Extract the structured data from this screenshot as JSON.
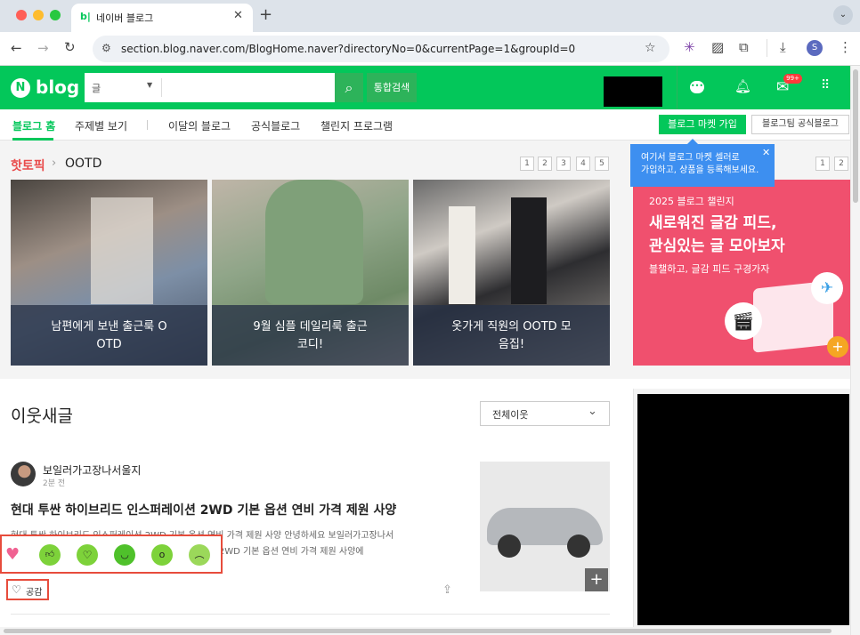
{
  "browser": {
    "tab_title": "네이버 블로그",
    "tab_favicon": "b|",
    "url": "section.blog.naver.com/BlogHome.naver?directoryNo=0&currentPage=1&groupId=0",
    "profile_initial": "S"
  },
  "header": {
    "logo_n": "N",
    "logo_text": "blog",
    "search_scope": "글",
    "search_value": "",
    "search_button": "통합검색",
    "notification_badge": "99+"
  },
  "gnb": {
    "items": [
      "블로그 홈",
      "주제별 보기",
      "이달의 블로그",
      "공식블로그",
      "챌린지 프로그램"
    ],
    "market_button": "블로그 마켓 가입",
    "official_button": "블로그팀 공식블로그"
  },
  "tooltip": {
    "line1": "여기서 블로그 마켓 셀러로",
    "line2": "가입하고, 상품을 등록해보세요."
  },
  "hot_topic": {
    "label": "핫토픽",
    "category": "OOTD",
    "pages": [
      "1",
      "2",
      "3",
      "4",
      "5"
    ],
    "cards": [
      {
        "l1": "남편에게 보낸 출근룩 O",
        "l2": "OTD"
      },
      {
        "l1": "9월 심플 데일리룩 출근",
        "l2": "코디!"
      },
      {
        "l1": "옷가게 직원의 OOTD 모",
        "l2": "음집!"
      }
    ]
  },
  "banner": {
    "year": "2025 블로그 챌린지",
    "title1": "새로워진 글감 피드,",
    "title2": "관심있는 글 모아보자",
    "desc": "블챌하고, 글감 피드 구경가자",
    "pages": [
      "1",
      "2"
    ]
  },
  "neighbors": {
    "title": "이웃새글",
    "filter": "전체이웃"
  },
  "post": {
    "author": "보일러가고장나서울지",
    "time": "2분 전",
    "title": "현대 투싼 하이브리드 인스퍼레이션 2WD 기본 옵션 연비 가격 제원 사양",
    "snippet1": "현대 투싼 하이브리드 인스퍼레이션 2WD 기본 옵션 연비 가격 제원 사양 안녕하세요 보일러가고장나서",
    "snippet2": "울지입니다. 오늘은 현대 투싼 하이브리드 인스퍼레이션 2WD 기본 옵션 연비 가격 제원 사양에",
    "like_label": "공감"
  }
}
